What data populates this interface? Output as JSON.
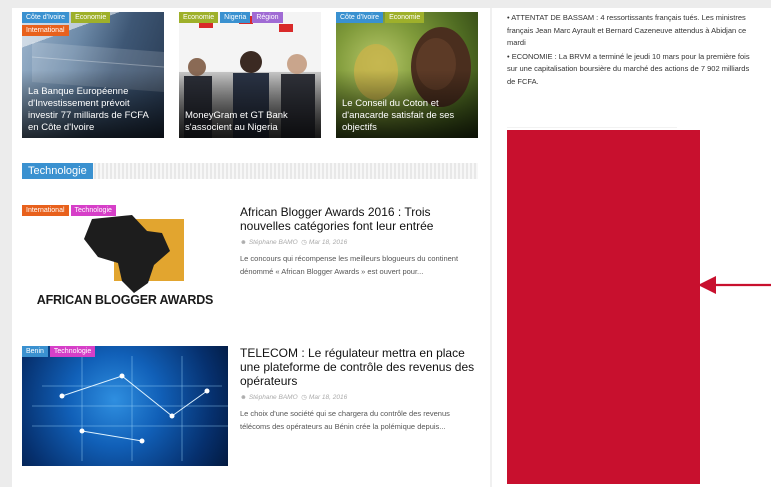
{
  "top_cards": [
    {
      "tags": [
        "Côte d'Ivoire",
        "Economie",
        "International"
      ],
      "title": "La Banque Européenne d'Investissement prévoit investir 77 milliards de FCFA en Côte d'Ivoire"
    },
    {
      "tags": [
        "Economie",
        "Nigeria",
        "Région"
      ],
      "title": "MoneyGram et GT Bank s'associent au Nigeria"
    },
    {
      "tags": [
        "Côte d'Ivoire",
        "Economie"
      ],
      "title": "Le Conseil du Coton et d'anacarde satisfait de ses objectifs"
    }
  ],
  "section": {
    "label": "Technologie"
  },
  "articles": [
    {
      "tags": [
        "International",
        "Technologie"
      ],
      "image_caption": "AFRICAN BLOGGER AWARDS",
      "title": "African Blogger Awards 2016 : Trois nouvelles catégories font leur entrée",
      "author": "Stéphane BAMO",
      "date": "Mar 18, 2016",
      "excerpt": "Le concours qui récompense les meilleurs blogueurs du continent dénommé « African Blogger Awards » est ouvert pour..."
    },
    {
      "tags": [
        "Benin",
        "Technologie"
      ],
      "title": "TELECOM : Le régulateur mettra en place une plateforme de contrôle des revenus des opérateurs",
      "author": "Stéphane BAMO",
      "date": "Mar 18, 2016",
      "excerpt": "Le choix d'une société qui se chargera du contrôle des revenus télécoms des opérateurs au Bénin crée la polémique depuis..."
    }
  ],
  "sidebar": {
    "news": [
      "ATTENTAT DE BASSAM : 4 ressortissants français tués. Les ministres français Jean Marc Ayrault et Bernard Cazeneuve attendus à Abidjan ce mardi",
      "ECONOMIE : La BRVM a terminé le jeudi 10 mars pour la première fois sur une capitalisation boursière du marché des actions de 7 902 milliards de FCFA."
    ]
  },
  "colors": {
    "highlight_block": "#c8102e",
    "arrow": "#c8102e",
    "section_accent": "#3a91d0"
  }
}
